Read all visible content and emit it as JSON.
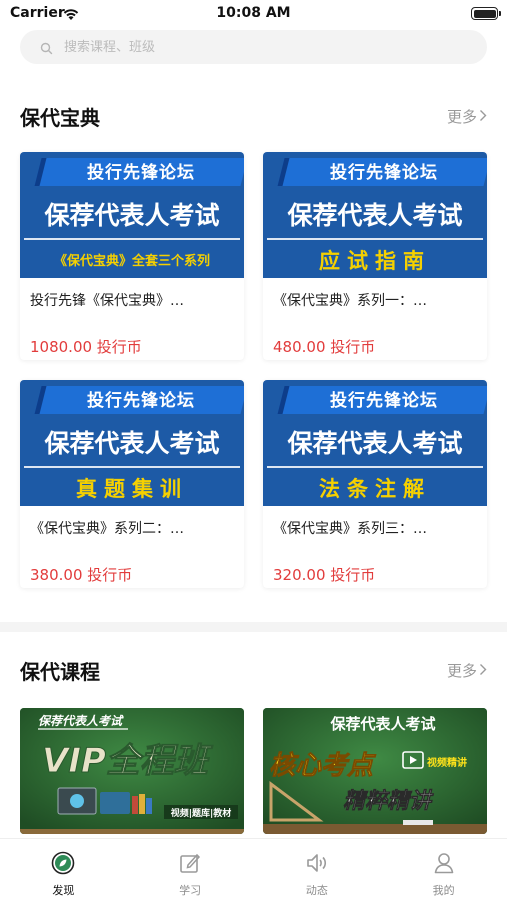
{
  "status_bar": {
    "carrier": "Carrier",
    "time": "10:08 AM"
  },
  "search": {
    "placeholder": "搜索课程、班级"
  },
  "section_books": {
    "title": "保代宝典",
    "more": "更多",
    "items": [
      {
        "banner_top": "投行先锋论坛",
        "banner_main": "保荐代表人考试",
        "banner_sub": "《保代宝典》全套三个系列",
        "title": "投行先锋《保代宝典》…",
        "price": "1080.00 投行币"
      },
      {
        "banner_top": "投行先锋论坛",
        "banner_main": "保荐代表人考试",
        "banner_sub": "应试指南",
        "title": "《保代宝典》系列一：…",
        "price": "480.00 投行币"
      },
      {
        "banner_top": "投行先锋论坛",
        "banner_main": "保荐代表人考试",
        "banner_sub": "真题集训",
        "title": "《保代宝典》系列二：…",
        "price": "380.00 投行币"
      },
      {
        "banner_top": "投行先锋论坛",
        "banner_main": "保荐代表人考试",
        "banner_sub": "法条注解",
        "title": "《保代宝典》系列三：…",
        "price": "320.00 投行币"
      }
    ]
  },
  "section_courses": {
    "title": "保代课程",
    "more": "更多",
    "items": [
      {
        "heading": "保荐代表人考试",
        "main": "VIP全程班",
        "tag": "视频|题库|教材"
      },
      {
        "heading": "保荐代表人考试",
        "main": "核心考点",
        "tag": "视频精讲",
        "sub": "精粹精讲"
      }
    ]
  },
  "tabbar": {
    "items": [
      {
        "label": "发现",
        "icon": "discover-icon",
        "active": true
      },
      {
        "label": "学习",
        "icon": "study-icon",
        "active": false
      },
      {
        "label": "动态",
        "icon": "speaker-icon",
        "active": false
      },
      {
        "label": "我的",
        "icon": "profile-icon",
        "active": false
      }
    ]
  },
  "colors": {
    "price": "#e23c3c",
    "banner_blue": "#1d5aa6",
    "banner_yellow": "#f5d000",
    "chalkboard_green": "#2e6b33",
    "tab_active_green": "#2e8b57"
  }
}
